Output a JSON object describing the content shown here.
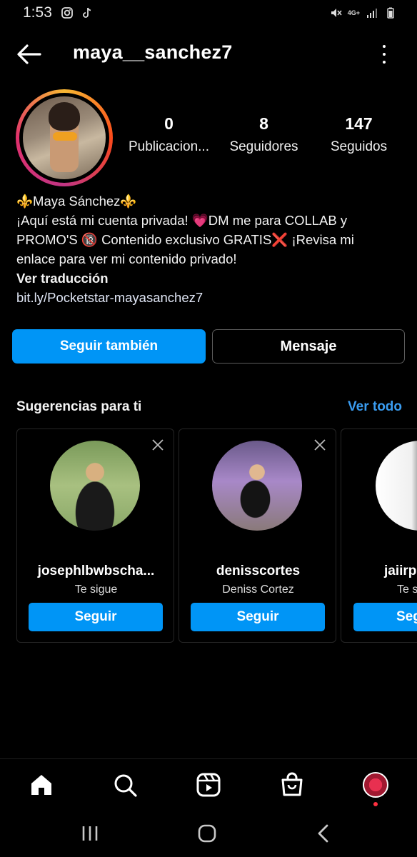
{
  "status_bar": {
    "time": "1:53",
    "left_icons": [
      "instagram-icon",
      "tiktok-icon"
    ],
    "right_icons": [
      "mute-icon",
      "network-4g-icon",
      "signal-icon",
      "battery-icon"
    ],
    "network_label": "4G+"
  },
  "header": {
    "username": "maya__sanchez7",
    "back_icon": "arrow-left-icon",
    "more_icon": "more-vertical-icon"
  },
  "profile": {
    "stats": [
      {
        "value": "0",
        "label": "Publicacion..."
      },
      {
        "value": "8",
        "label": "Seguidores"
      },
      {
        "value": "147",
        "label": "Seguidos"
      }
    ],
    "bio": {
      "name_line": "⚜️Maya Sánchez⚜️",
      "line1": "¡Aquí está mi cuenta privada! 💗DM me para COLLAB y",
      "line2": "PROMO'S 🔞 Contenido exclusivo GRATIS❌ ¡Revisa mi",
      "line3": "enlace para ver mi contenido privado!",
      "translate": "Ver traducción",
      "link": "bit.ly/Pocketstar-mayasanchez7"
    }
  },
  "actions": {
    "follow_back": "Seguir también",
    "message": "Mensaje"
  },
  "suggestions": {
    "title": "Sugerencias para ti",
    "see_all": "Ver todo",
    "cards": [
      {
        "username": "josephlbwbscha...",
        "subtitle": "Te sigue",
        "button": "Seguir"
      },
      {
        "username": "denisscortes",
        "subtitle": "Deniss Cortez",
        "button": "Seguir"
      },
      {
        "username": "jaiirpl",
        "subtitle": "Te s",
        "button": "Seg"
      }
    ]
  },
  "bottom_nav": {
    "items": [
      "home-icon",
      "search-icon",
      "reels-icon",
      "shop-icon",
      "profile-avatar"
    ]
  },
  "system_nav": {
    "items": [
      "recents-icon",
      "home-circle-icon",
      "back-chevron-icon"
    ]
  },
  "colors": {
    "accent": "#0095f6",
    "link_blue": "#3a9cf0",
    "background": "#000000"
  }
}
